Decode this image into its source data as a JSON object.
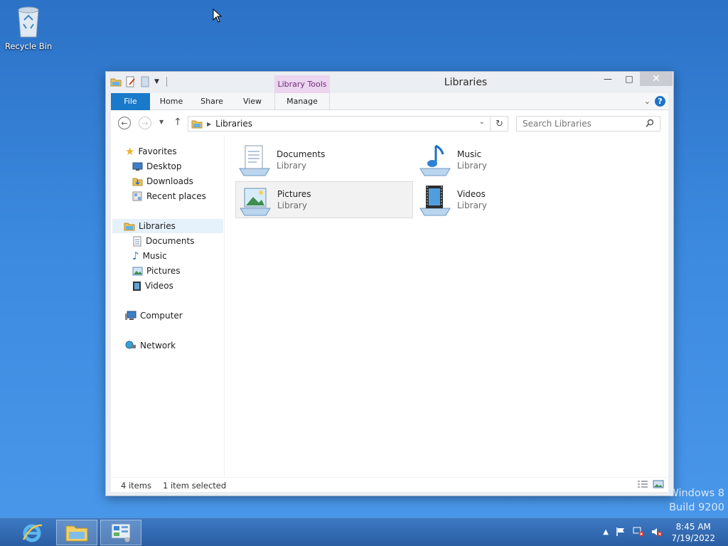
{
  "desktop": {
    "recycle_bin_label": "Recycle Bin",
    "watermark_line1": "Windows 8",
    "watermark_line2": "Build 9200"
  },
  "window": {
    "title": "Libraries",
    "contextual_tab": "Library Tools",
    "controls": {
      "minimize": "—",
      "maximize": "□",
      "close": "✕"
    }
  },
  "ribbon": {
    "tabs": [
      {
        "label": "File"
      },
      {
        "label": "Home"
      },
      {
        "label": "Share"
      },
      {
        "label": "View"
      },
      {
        "label": "Manage"
      }
    ],
    "help": "?"
  },
  "navigation": {
    "address_segment": "Libraries",
    "search_placeholder": "Search Libraries"
  },
  "nav_pane": {
    "favorites": "Favorites",
    "favorites_items": [
      "Desktop",
      "Downloads",
      "Recent places"
    ],
    "libraries": "Libraries",
    "libraries_items": [
      "Documents",
      "Music",
      "Pictures",
      "Videos"
    ],
    "computer": "Computer",
    "network": "Network"
  },
  "content": {
    "items": [
      {
        "name": "Documents",
        "type": "Library",
        "icon": "documents-library-icon"
      },
      {
        "name": "Music",
        "type": "Library",
        "icon": "music-library-icon"
      },
      {
        "name": "Pictures",
        "type": "Library",
        "icon": "pictures-library-icon",
        "selected": true
      },
      {
        "name": "Videos",
        "type": "Library",
        "icon": "videos-library-icon"
      }
    ]
  },
  "status": {
    "item_count": "4 items",
    "selected_count": "1 item selected"
  },
  "taskbar": {
    "time": "8:45 AM",
    "date": "7/19/2022"
  },
  "colors": {
    "accent": "#1979ca",
    "contextual_tab_bg": "#ecd5ef",
    "desktop_bg": "#3b8ae0"
  }
}
